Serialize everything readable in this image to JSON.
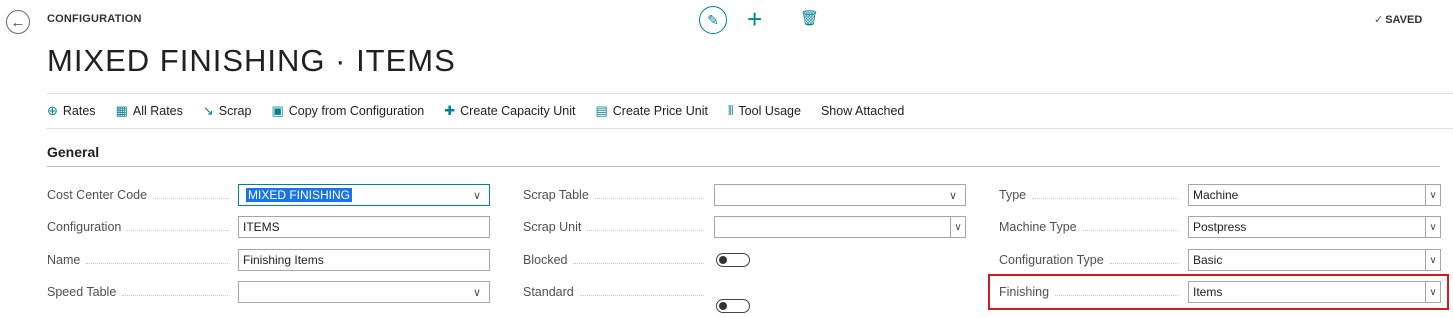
{
  "header": {
    "breadcrumb": "CONFIGURATION",
    "saved_label": "SAVED",
    "title": "MIXED FINISHING · ITEMS"
  },
  "actions": [
    {
      "label": "Rates",
      "icon": "rates-icon"
    },
    {
      "label": "All Rates",
      "icon": "all-rates-icon"
    },
    {
      "label": "Scrap",
      "icon": "scrap-icon"
    },
    {
      "label": "Copy from Configuration",
      "icon": "copy-icon"
    },
    {
      "label": "Create Capacity Unit",
      "icon": "capacity-icon"
    },
    {
      "label": "Create Price Unit",
      "icon": "price-icon"
    },
    {
      "label": "Tool Usage",
      "icon": "tool-icon"
    },
    {
      "label": "Show Attached",
      "icon": ""
    }
  ],
  "general": {
    "section_title": "General",
    "col1": {
      "cost_center_code": {
        "label": "Cost Center Code",
        "value": "MIXED FINISHING"
      },
      "configuration": {
        "label": "Configuration",
        "value": "ITEMS"
      },
      "name": {
        "label": "Name",
        "value": "Finishing Items"
      },
      "speed_table": {
        "label": "Speed Table",
        "value": ""
      }
    },
    "col2": {
      "scrap_table": {
        "label": "Scrap Table",
        "value": ""
      },
      "scrap_unit": {
        "label": "Scrap Unit",
        "value": ""
      },
      "blocked": {
        "label": "Blocked",
        "value": false
      },
      "standard": {
        "label": "Standard",
        "value": false
      }
    },
    "col3": {
      "type": {
        "label": "Type",
        "value": "Machine"
      },
      "machine_type": {
        "label": "Machine Type",
        "value": "Postpress"
      },
      "configuration_type": {
        "label": "Configuration Type",
        "value": "Basic"
      },
      "finishing": {
        "label": "Finishing",
        "value": "Items"
      }
    }
  },
  "colors": {
    "accent": "#00838f",
    "highlight": "#d01c1c",
    "selection": "#1a73e8"
  }
}
